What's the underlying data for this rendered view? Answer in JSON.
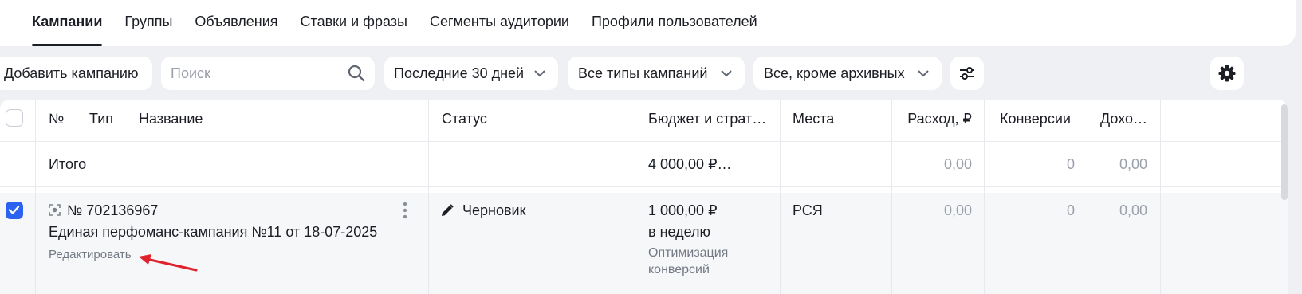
{
  "tabs": [
    {
      "label": "Кампании",
      "active": true
    },
    {
      "label": "Группы"
    },
    {
      "label": "Объявления"
    },
    {
      "label": "Ставки и фразы"
    },
    {
      "label": "Сегменты аудитории"
    },
    {
      "label": "Профили пользователей"
    }
  ],
  "toolbar": {
    "add_campaign": "Добавить кампанию",
    "search_placeholder": "Поиск",
    "period": "Последние 30 дней",
    "campaign_types": "Все типы кампаний",
    "archive_filter": "Все, кроме архивных"
  },
  "table": {
    "headers": {
      "num": "№",
      "type": "Тип",
      "name": "Название",
      "status": "Статус",
      "budget": "Бюджет и страт…",
      "places": "Места",
      "expense": "Расход, ₽",
      "conversions": "Конверсии",
      "income": "Дохо…"
    },
    "total": {
      "label": "Итого",
      "budget": "4 000,00 ₽…",
      "expense": "0,00",
      "conversions": "0",
      "income": "0,00"
    },
    "row": {
      "id": "№ 702136967",
      "name": "Единая перфоманс-кампания №11 от 18-07-2025",
      "edit": "Редактировать",
      "status": "Черновик",
      "budget_amount": "1 000,00 ₽",
      "budget_period": "в неделю",
      "strategy": "Оптимизация конверсий",
      "strategy_line1": "Оптимизация",
      "strategy_line2": "конверсий",
      "places": "РСЯ",
      "expense": "0,00",
      "conversions": "0",
      "income": "0,00",
      "checked": true
    }
  },
  "colors": {
    "accent": "#2b63f0",
    "annotation_arrow": "#e0202a"
  }
}
